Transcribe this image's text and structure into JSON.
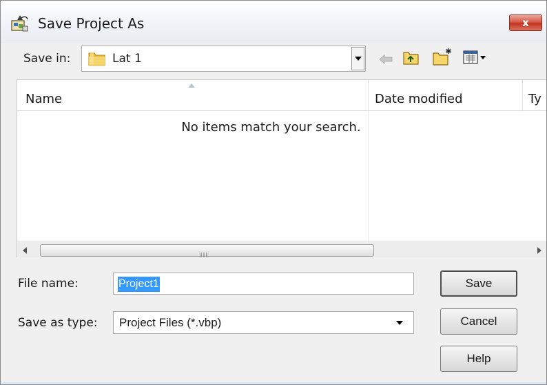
{
  "window": {
    "title": "Save Project As",
    "close_label": "x"
  },
  "toolbar": {
    "save_in_label": "Save in:",
    "save_in_value": "Lat 1"
  },
  "list": {
    "columns": [
      "Name",
      "Date modified",
      "Ty"
    ],
    "empty_message": "No items match your search.",
    "thumb_grip": "III"
  },
  "form": {
    "file_name_label": "File name:",
    "file_name_value": "Project1",
    "save_as_type_label": "Save as type:",
    "save_as_type_value": "Project Files (*.vbp)"
  },
  "buttons": {
    "save": "Save",
    "cancel": "Cancel",
    "help": "Help"
  },
  "colors": {
    "close_red": "#c4331f",
    "selection_blue": "#3399ff",
    "folder_yellow": "#e8b93c"
  },
  "icons": [
    "vb-project-icon",
    "folder-icon",
    "back-arrow-icon",
    "up-folder-icon",
    "new-folder-icon",
    "view-menu-icon"
  ]
}
